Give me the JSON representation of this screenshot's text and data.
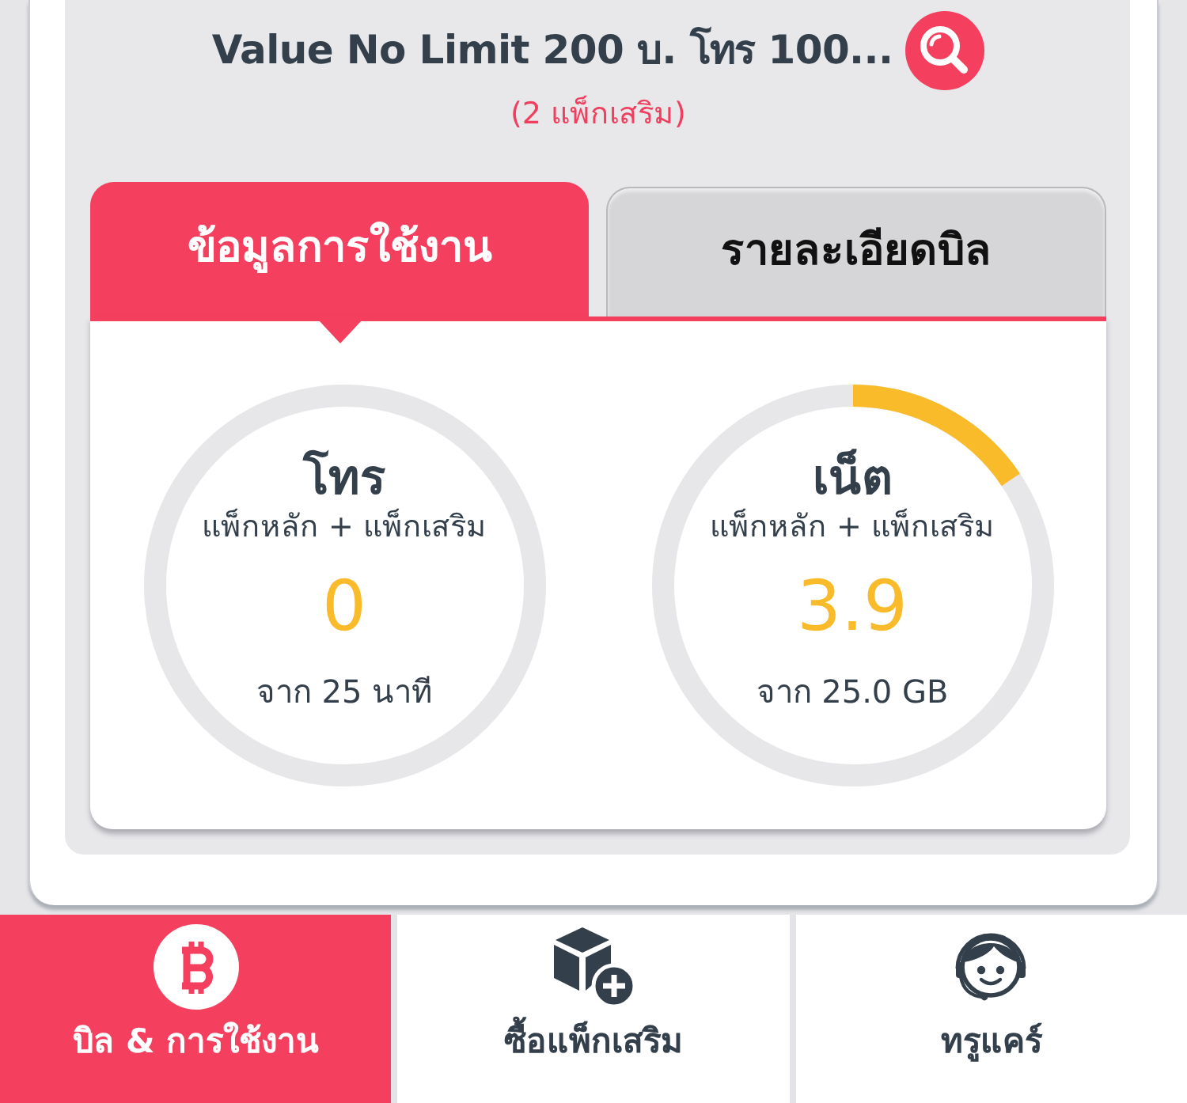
{
  "package": {
    "title": "Value No Limit 200 บ. โทร 100...",
    "addons": "(2 แพ็กเสริม)"
  },
  "tabs": [
    {
      "label": "ข้อมูลการใช้งาน",
      "selected": true
    },
    {
      "label": "รายละเอียดบิล",
      "selected": false
    }
  ],
  "usage": [
    {
      "name": "โทร",
      "subtitle": "แพ็กหลัก + แพ็กเสริม",
      "used": "0",
      "total": "จาก 25 นาที",
      "level": 0
    },
    {
      "name": "เน็ต",
      "subtitle": "แพ็กหลัก + แพ็กเสริม",
      "used": "3.9",
      "total": "จาก 25.0 GB",
      "level": 0.156
    }
  ],
  "bottom_nav": [
    {
      "kind": "bill",
      "label": "บิล & การใช้งาน",
      "selected": true
    },
    {
      "kind": "addon",
      "label": "ซื้อแพ็กเสริม",
      "selected": false
    },
    {
      "kind": "care",
      "label": "ทรูแคร์",
      "selected": false
    }
  ]
}
